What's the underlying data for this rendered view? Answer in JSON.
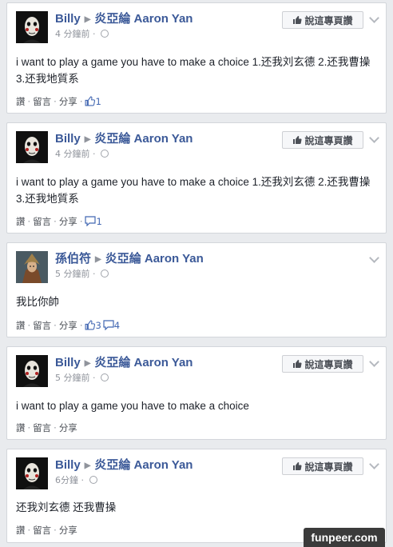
{
  "posts": [
    {
      "author": "Billy",
      "page": "炎亞綸 Aaron Yan",
      "time": "4 分鐘前",
      "like_page_label": "說這專頁讚",
      "text": "i want to play a game you have to make a choice 1.还我刘玄德 2.还我曹操 3.还我地質系",
      "actions": [
        "讚",
        "留言",
        "分享"
      ],
      "likes": "1",
      "comments": ""
    },
    {
      "author": "Billy",
      "page": "炎亞綸 Aaron Yan",
      "time": "4 分鐘前",
      "like_page_label": "說這專頁讚",
      "text": "i want to play a game you have to make a choice 1.还我刘玄德 2.还我曹操 3.还我地質系",
      "actions": [
        "讚",
        "留言",
        "分享"
      ],
      "likes": "",
      "comments": "1"
    },
    {
      "author": "孫伯符",
      "page": "炎亞綸 Aaron Yan",
      "time": "5 分鐘前",
      "like_page_label": "",
      "text": "我比你帥",
      "actions": [
        "讚",
        "留言",
        "分享"
      ],
      "likes": "3",
      "comments": "4"
    },
    {
      "author": "Billy",
      "page": "炎亞綸 Aaron Yan",
      "time": "5 分鐘前",
      "like_page_label": "說這專頁讚",
      "text": "i want to play a game you have to make a choice",
      "actions": [
        "讚",
        "留言",
        "分享"
      ],
      "likes": "",
      "comments": ""
    },
    {
      "author": "Billy",
      "page": "炎亞綸 Aaron Yan",
      "time": "6分鐘",
      "like_page_label": "說這專頁讚",
      "text": "还我刘玄德 还我曹操",
      "actions": [
        "讚",
        "留言",
        "分享"
      ],
      "likes": "",
      "comments": ""
    }
  ],
  "watermark": "funpeer.com",
  "colors": {
    "link": "#3b5998",
    "meta": "#90949c",
    "background": "#e9ebee"
  }
}
